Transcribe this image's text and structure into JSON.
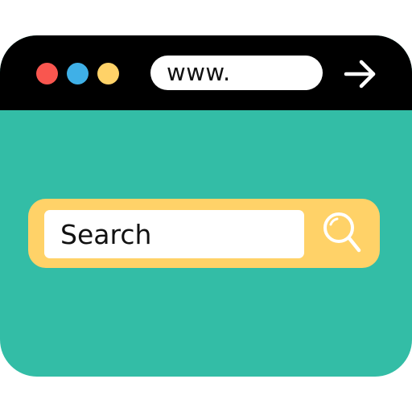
{
  "window": {
    "controls": [
      {
        "name": "close",
        "color": "#f9564f"
      },
      {
        "name": "minimize",
        "color": "#3fb0e7"
      },
      {
        "name": "maximize",
        "color": "#ffd268"
      }
    ],
    "address_bar": {
      "text": "www."
    },
    "go_icon": "arrow-right-icon"
  },
  "search": {
    "value": "Search",
    "icon": "search-icon"
  },
  "colors": {
    "titlebar": "#000000",
    "page_background": "#33bda6",
    "search_bar": "#ffd268",
    "input_background": "#ffffff"
  }
}
